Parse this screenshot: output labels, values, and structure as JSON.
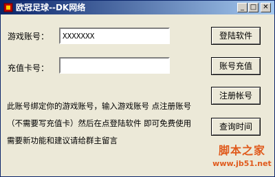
{
  "window": {
    "title": "欧冠足球--DK网络",
    "controls": {
      "minimize": "_",
      "maximize": "□",
      "close": "✕"
    }
  },
  "form": {
    "account_label": "游戏账号：",
    "account_value": "XXXXXXX",
    "card_label": "充值卡号：",
    "card_value": ""
  },
  "buttons": {
    "login": "登陆软件",
    "recharge": "账号充值",
    "register": "注册帐号",
    "query": "查询时间"
  },
  "info": [
    "此账号绑定你的游戏账号，输入游戏账号 点注册账号",
    "（不需要写充值卡）然后在点登陆软件 即可免费使用",
    "需要新功能和建议请给群主留言"
  ],
  "watermark": {
    "logo": "脚本之家",
    "url": "www.jb51.net"
  }
}
